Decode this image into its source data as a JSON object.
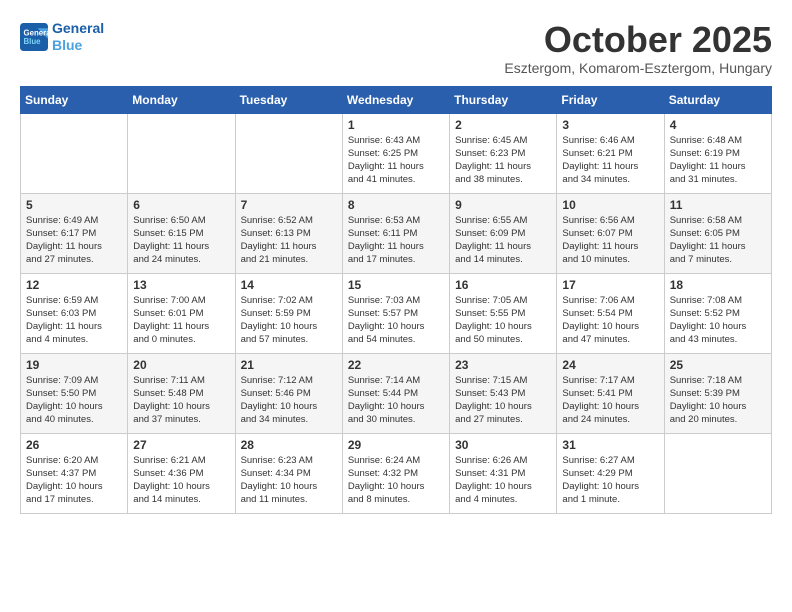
{
  "logo": {
    "line1": "General",
    "line2": "Blue"
  },
  "title": "October 2025",
  "location": "Esztergom, Komarom-Esztergom, Hungary",
  "days_of_week": [
    "Sunday",
    "Monday",
    "Tuesday",
    "Wednesday",
    "Thursday",
    "Friday",
    "Saturday"
  ],
  "weeks": [
    [
      {
        "day": "",
        "info": ""
      },
      {
        "day": "",
        "info": ""
      },
      {
        "day": "",
        "info": ""
      },
      {
        "day": "1",
        "info": "Sunrise: 6:43 AM\nSunset: 6:25 PM\nDaylight: 11 hours\nand 41 minutes."
      },
      {
        "day": "2",
        "info": "Sunrise: 6:45 AM\nSunset: 6:23 PM\nDaylight: 11 hours\nand 38 minutes."
      },
      {
        "day": "3",
        "info": "Sunrise: 6:46 AM\nSunset: 6:21 PM\nDaylight: 11 hours\nand 34 minutes."
      },
      {
        "day": "4",
        "info": "Sunrise: 6:48 AM\nSunset: 6:19 PM\nDaylight: 11 hours\nand 31 minutes."
      }
    ],
    [
      {
        "day": "5",
        "info": "Sunrise: 6:49 AM\nSunset: 6:17 PM\nDaylight: 11 hours\nand 27 minutes."
      },
      {
        "day": "6",
        "info": "Sunrise: 6:50 AM\nSunset: 6:15 PM\nDaylight: 11 hours\nand 24 minutes."
      },
      {
        "day": "7",
        "info": "Sunrise: 6:52 AM\nSunset: 6:13 PM\nDaylight: 11 hours\nand 21 minutes."
      },
      {
        "day": "8",
        "info": "Sunrise: 6:53 AM\nSunset: 6:11 PM\nDaylight: 11 hours\nand 17 minutes."
      },
      {
        "day": "9",
        "info": "Sunrise: 6:55 AM\nSunset: 6:09 PM\nDaylight: 11 hours\nand 14 minutes."
      },
      {
        "day": "10",
        "info": "Sunrise: 6:56 AM\nSunset: 6:07 PM\nDaylight: 11 hours\nand 10 minutes."
      },
      {
        "day": "11",
        "info": "Sunrise: 6:58 AM\nSunset: 6:05 PM\nDaylight: 11 hours\nand 7 minutes."
      }
    ],
    [
      {
        "day": "12",
        "info": "Sunrise: 6:59 AM\nSunset: 6:03 PM\nDaylight: 11 hours\nand 4 minutes."
      },
      {
        "day": "13",
        "info": "Sunrise: 7:00 AM\nSunset: 6:01 PM\nDaylight: 11 hours\nand 0 minutes."
      },
      {
        "day": "14",
        "info": "Sunrise: 7:02 AM\nSunset: 5:59 PM\nDaylight: 10 hours\nand 57 minutes."
      },
      {
        "day": "15",
        "info": "Sunrise: 7:03 AM\nSunset: 5:57 PM\nDaylight: 10 hours\nand 54 minutes."
      },
      {
        "day": "16",
        "info": "Sunrise: 7:05 AM\nSunset: 5:55 PM\nDaylight: 10 hours\nand 50 minutes."
      },
      {
        "day": "17",
        "info": "Sunrise: 7:06 AM\nSunset: 5:54 PM\nDaylight: 10 hours\nand 47 minutes."
      },
      {
        "day": "18",
        "info": "Sunrise: 7:08 AM\nSunset: 5:52 PM\nDaylight: 10 hours\nand 43 minutes."
      }
    ],
    [
      {
        "day": "19",
        "info": "Sunrise: 7:09 AM\nSunset: 5:50 PM\nDaylight: 10 hours\nand 40 minutes."
      },
      {
        "day": "20",
        "info": "Sunrise: 7:11 AM\nSunset: 5:48 PM\nDaylight: 10 hours\nand 37 minutes."
      },
      {
        "day": "21",
        "info": "Sunrise: 7:12 AM\nSunset: 5:46 PM\nDaylight: 10 hours\nand 34 minutes."
      },
      {
        "day": "22",
        "info": "Sunrise: 7:14 AM\nSunset: 5:44 PM\nDaylight: 10 hours\nand 30 minutes."
      },
      {
        "day": "23",
        "info": "Sunrise: 7:15 AM\nSunset: 5:43 PM\nDaylight: 10 hours\nand 27 minutes."
      },
      {
        "day": "24",
        "info": "Sunrise: 7:17 AM\nSunset: 5:41 PM\nDaylight: 10 hours\nand 24 minutes."
      },
      {
        "day": "25",
        "info": "Sunrise: 7:18 AM\nSunset: 5:39 PM\nDaylight: 10 hours\nand 20 minutes."
      }
    ],
    [
      {
        "day": "26",
        "info": "Sunrise: 6:20 AM\nSunset: 4:37 PM\nDaylight: 10 hours\nand 17 minutes."
      },
      {
        "day": "27",
        "info": "Sunrise: 6:21 AM\nSunset: 4:36 PM\nDaylight: 10 hours\nand 14 minutes."
      },
      {
        "day": "28",
        "info": "Sunrise: 6:23 AM\nSunset: 4:34 PM\nDaylight: 10 hours\nand 11 minutes."
      },
      {
        "day": "29",
        "info": "Sunrise: 6:24 AM\nSunset: 4:32 PM\nDaylight: 10 hours\nand 8 minutes."
      },
      {
        "day": "30",
        "info": "Sunrise: 6:26 AM\nSunset: 4:31 PM\nDaylight: 10 hours\nand 4 minutes."
      },
      {
        "day": "31",
        "info": "Sunrise: 6:27 AM\nSunset: 4:29 PM\nDaylight: 10 hours\nand 1 minute."
      },
      {
        "day": "",
        "info": ""
      }
    ]
  ]
}
